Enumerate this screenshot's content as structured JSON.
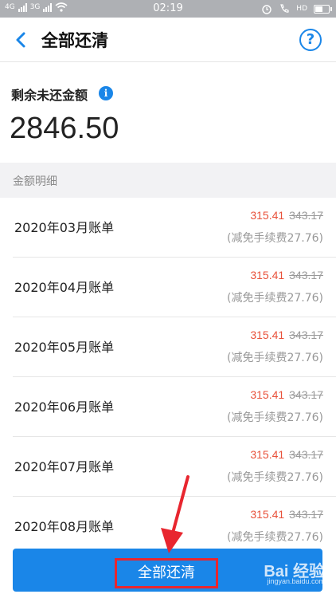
{
  "status_bar": {
    "time": "02:19",
    "network": "4G",
    "signal2": "3G",
    "hd": "HD"
  },
  "nav": {
    "title": "全部还清",
    "help_glyph": "?"
  },
  "remaining": {
    "label": "剩余未还金额",
    "info_glyph": "i",
    "value": "2846.50"
  },
  "section": {
    "title": "金额明细"
  },
  "bills": [
    {
      "name": "2020年03月账单",
      "current": "315.41",
      "original": "343.17",
      "waive": "(减免手续费27.76)"
    },
    {
      "name": "2020年04月账单",
      "current": "315.41",
      "original": "343.17",
      "waive": "(减免手续费27.76)"
    },
    {
      "name": "2020年05月账单",
      "current": "315.41",
      "original": "343.17",
      "waive": "(减免手续费27.76)"
    },
    {
      "name": "2020年06月账单",
      "current": "315.41",
      "original": "343.17",
      "waive": "(减免手续费27.76)"
    },
    {
      "name": "2020年07月账单",
      "current": "315.41",
      "original": "343.17",
      "waive": "(减免手续费27.76)"
    },
    {
      "name": "2020年08月账单",
      "current": "315.41",
      "original": "343.17",
      "waive": "(减免手续费27.76)"
    }
  ],
  "button": {
    "label": "全部还清"
  },
  "watermark": {
    "brand": "Bai 经验",
    "url": "jingyan.baidu.com"
  },
  "colors": {
    "accent": "#1a86e8",
    "price": "#e8513a",
    "highlight": "#e8262f"
  }
}
